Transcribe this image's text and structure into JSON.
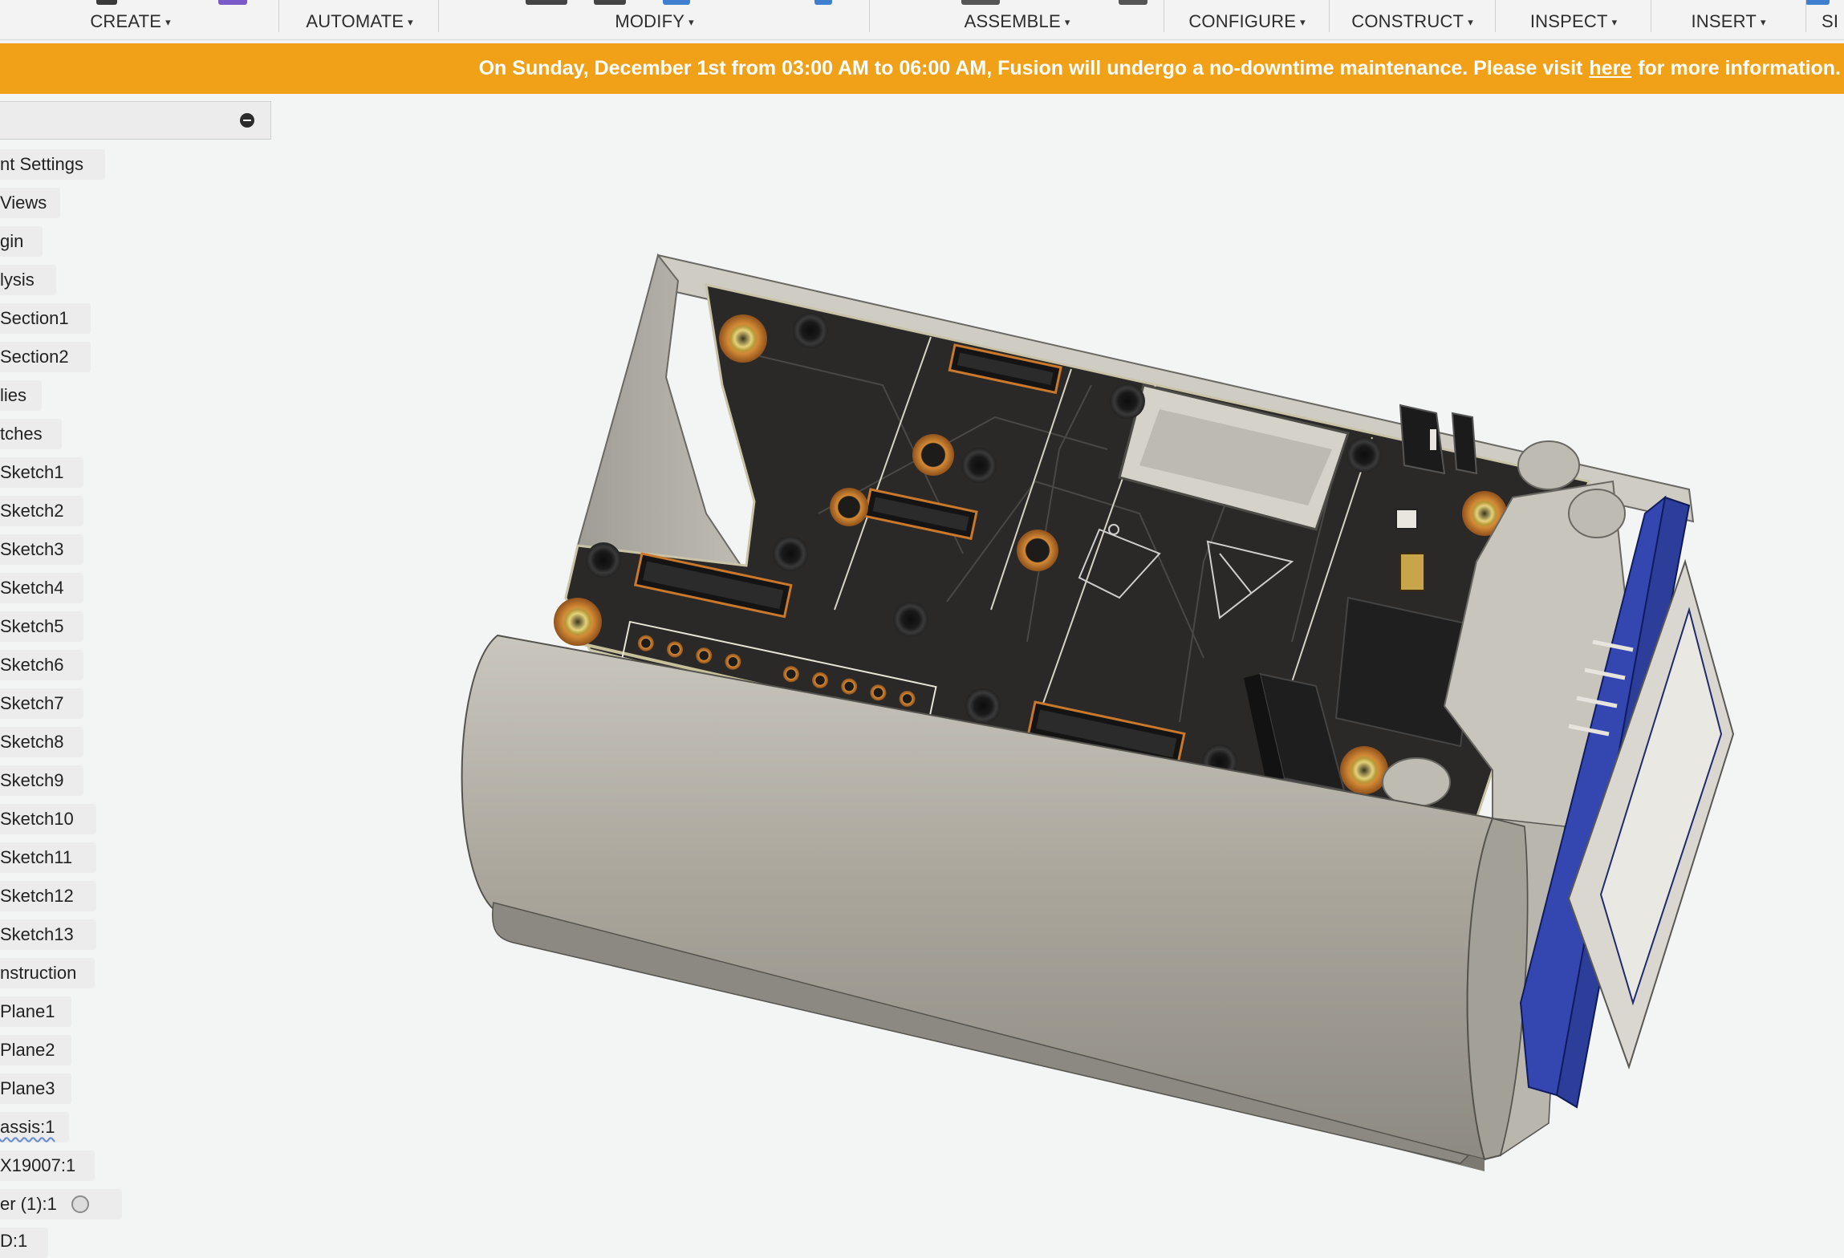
{
  "toolbar": {
    "groups": [
      {
        "label": "CREATE"
      },
      {
        "label": "AUTOMATE"
      },
      {
        "label": "MODIFY"
      },
      {
        "label": "ASSEMBLE"
      },
      {
        "label": "CONFIGURE"
      },
      {
        "label": "CONSTRUCT"
      },
      {
        "label": "INSPECT"
      },
      {
        "label": "INSERT"
      },
      {
        "label": "SI"
      }
    ],
    "caret": "▾"
  },
  "banner": {
    "text_before": "On Sunday, December 1st from 03:00 AM to 06:00 AM, Fusion will undergo a no-downtime maintenance. Please visit",
    "link": "here",
    "text_after": "for more information."
  },
  "browser": {
    "items": [
      {
        "label": "nt Settings"
      },
      {
        "label": "Views"
      },
      {
        "label": "gin"
      },
      {
        "label": "lysis"
      },
      {
        "label": "Section1"
      },
      {
        "label": "Section2"
      },
      {
        "label": "lies"
      },
      {
        "label": "tches"
      },
      {
        "label": "Sketch1"
      },
      {
        "label": "Sketch2"
      },
      {
        "label": "Sketch3"
      },
      {
        "label": "Sketch4"
      },
      {
        "label": "Sketch5"
      },
      {
        "label": "Sketch6"
      },
      {
        "label": "Sketch7"
      },
      {
        "label": "Sketch8"
      },
      {
        "label": "Sketch9"
      },
      {
        "label": "Sketch10"
      },
      {
        "label": "Sketch11"
      },
      {
        "label": "Sketch12"
      },
      {
        "label": "Sketch13"
      },
      {
        "label": "nstruction"
      },
      {
        "label": "Plane1"
      },
      {
        "label": "Plane2"
      },
      {
        "label": "Plane3"
      },
      {
        "label": "assis:1"
      },
      {
        "label": "X19007:1"
      },
      {
        "label": "er (1):1"
      },
      {
        "label": "D:1"
      }
    ]
  },
  "colors": {
    "banner": "#f0a118",
    "pcb": "#2a2927",
    "housing": "#b6b2a8",
    "mount_ring": "#c9782c",
    "display_board": "#2c3d9a"
  },
  "icons": {
    "collapse": "minus-circle-icon",
    "visibility": "radio-circle-icon"
  }
}
